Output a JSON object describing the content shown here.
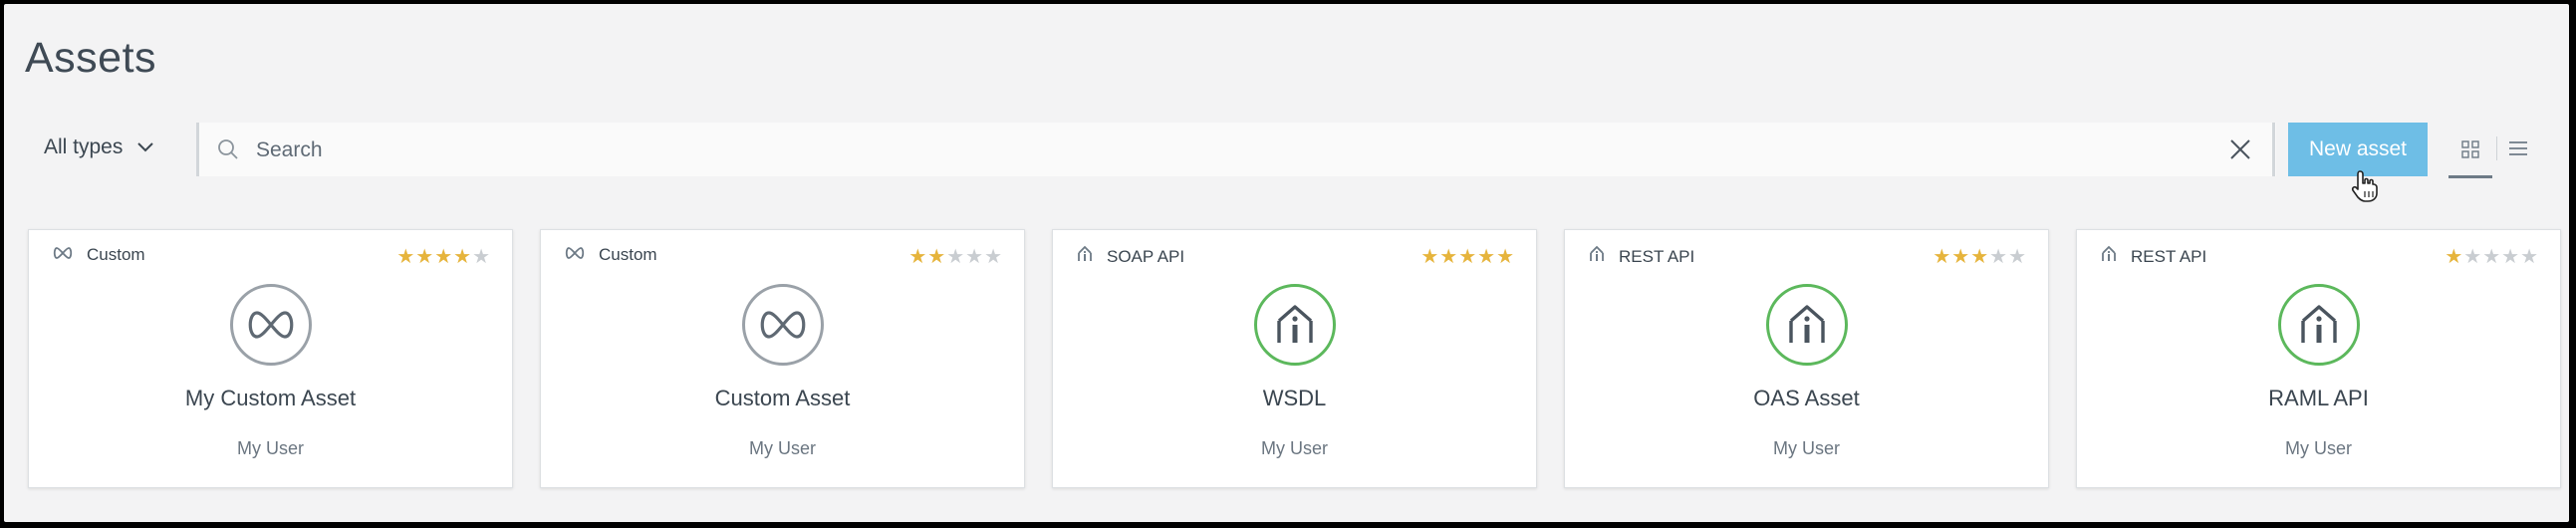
{
  "page": {
    "title": "Assets"
  },
  "toolbar": {
    "type_filter": "All types",
    "search_placeholder": "Search",
    "new_asset_label": "New asset",
    "active_view": "grid"
  },
  "colors": {
    "accent": "#6ebee6",
    "star_on": "#e6b43c",
    "star_off": "#c9cdd1",
    "api_ring": "#5cb85c",
    "custom_ring": "#9aa1a8"
  },
  "assets": [
    {
      "type": "Custom",
      "name": "My Custom Asset",
      "owner": "My User",
      "rating": 4,
      "max_rating": 5,
      "icon": "custom-asset-icon"
    },
    {
      "type": "Custom",
      "name": "Custom Asset",
      "owner": "My User",
      "rating": 2,
      "max_rating": 5,
      "icon": "custom-asset-icon"
    },
    {
      "type": "SOAP API",
      "name": "WSDL",
      "owner": "My User",
      "rating": 5,
      "max_rating": 5,
      "icon": "api-icon"
    },
    {
      "type": "REST API",
      "name": "OAS Asset",
      "owner": "My User",
      "rating": 3,
      "max_rating": 5,
      "icon": "api-icon"
    },
    {
      "type": "REST API",
      "name": "RAML API",
      "owner": "My User",
      "rating": 1,
      "max_rating": 5,
      "icon": "api-icon"
    }
  ]
}
